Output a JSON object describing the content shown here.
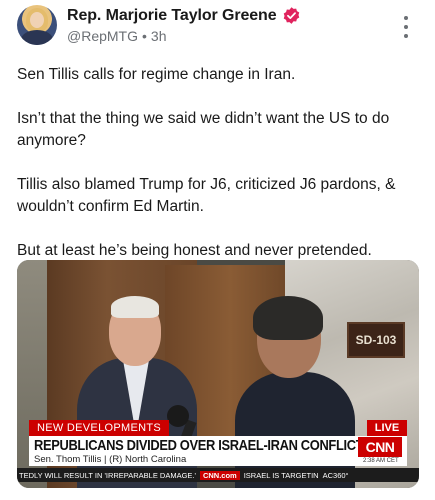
{
  "header": {
    "display_name": "Rep. Marjorie Taylor Greene",
    "handle": "@RepMTG",
    "separator": "•",
    "timestamp": "3h"
  },
  "post": {
    "paragraphs": [
      "Sen Tillis calls for regime change in Iran.",
      "Isn’t that the thing we said we didn’t want the US to do anymore?",
      "Tillis also blamed Trump for J6, criticized J6 pardons, & wouldn’t confirm Ed Martin.",
      "But at least he’s being honest and never pretended."
    ]
  },
  "media": {
    "sign_text": "SD-103",
    "chyron": {
      "tag": "NEW DEVELOPMENTS",
      "live": "LIVE",
      "headline": "REPUBLICANS DIVIDED OVER ISRAEL-IRAN CONFLICT",
      "subline": "Sen. Thom Tillis  |  (R) North Carolina",
      "logo": "CNN",
      "time": "2:38 AM CET",
      "ticker_left": "TEDLY WILL RESULT IN 'IRREPARABLE DAMAGE.'",
      "ticker_cnn": "CNN.com",
      "ticker_right": "ISRAEL IS TARGETIN",
      "ticker_end": "AC360°"
    }
  },
  "colors": {
    "verified": "#e0245e",
    "cnn_red": "#cc0000"
  }
}
